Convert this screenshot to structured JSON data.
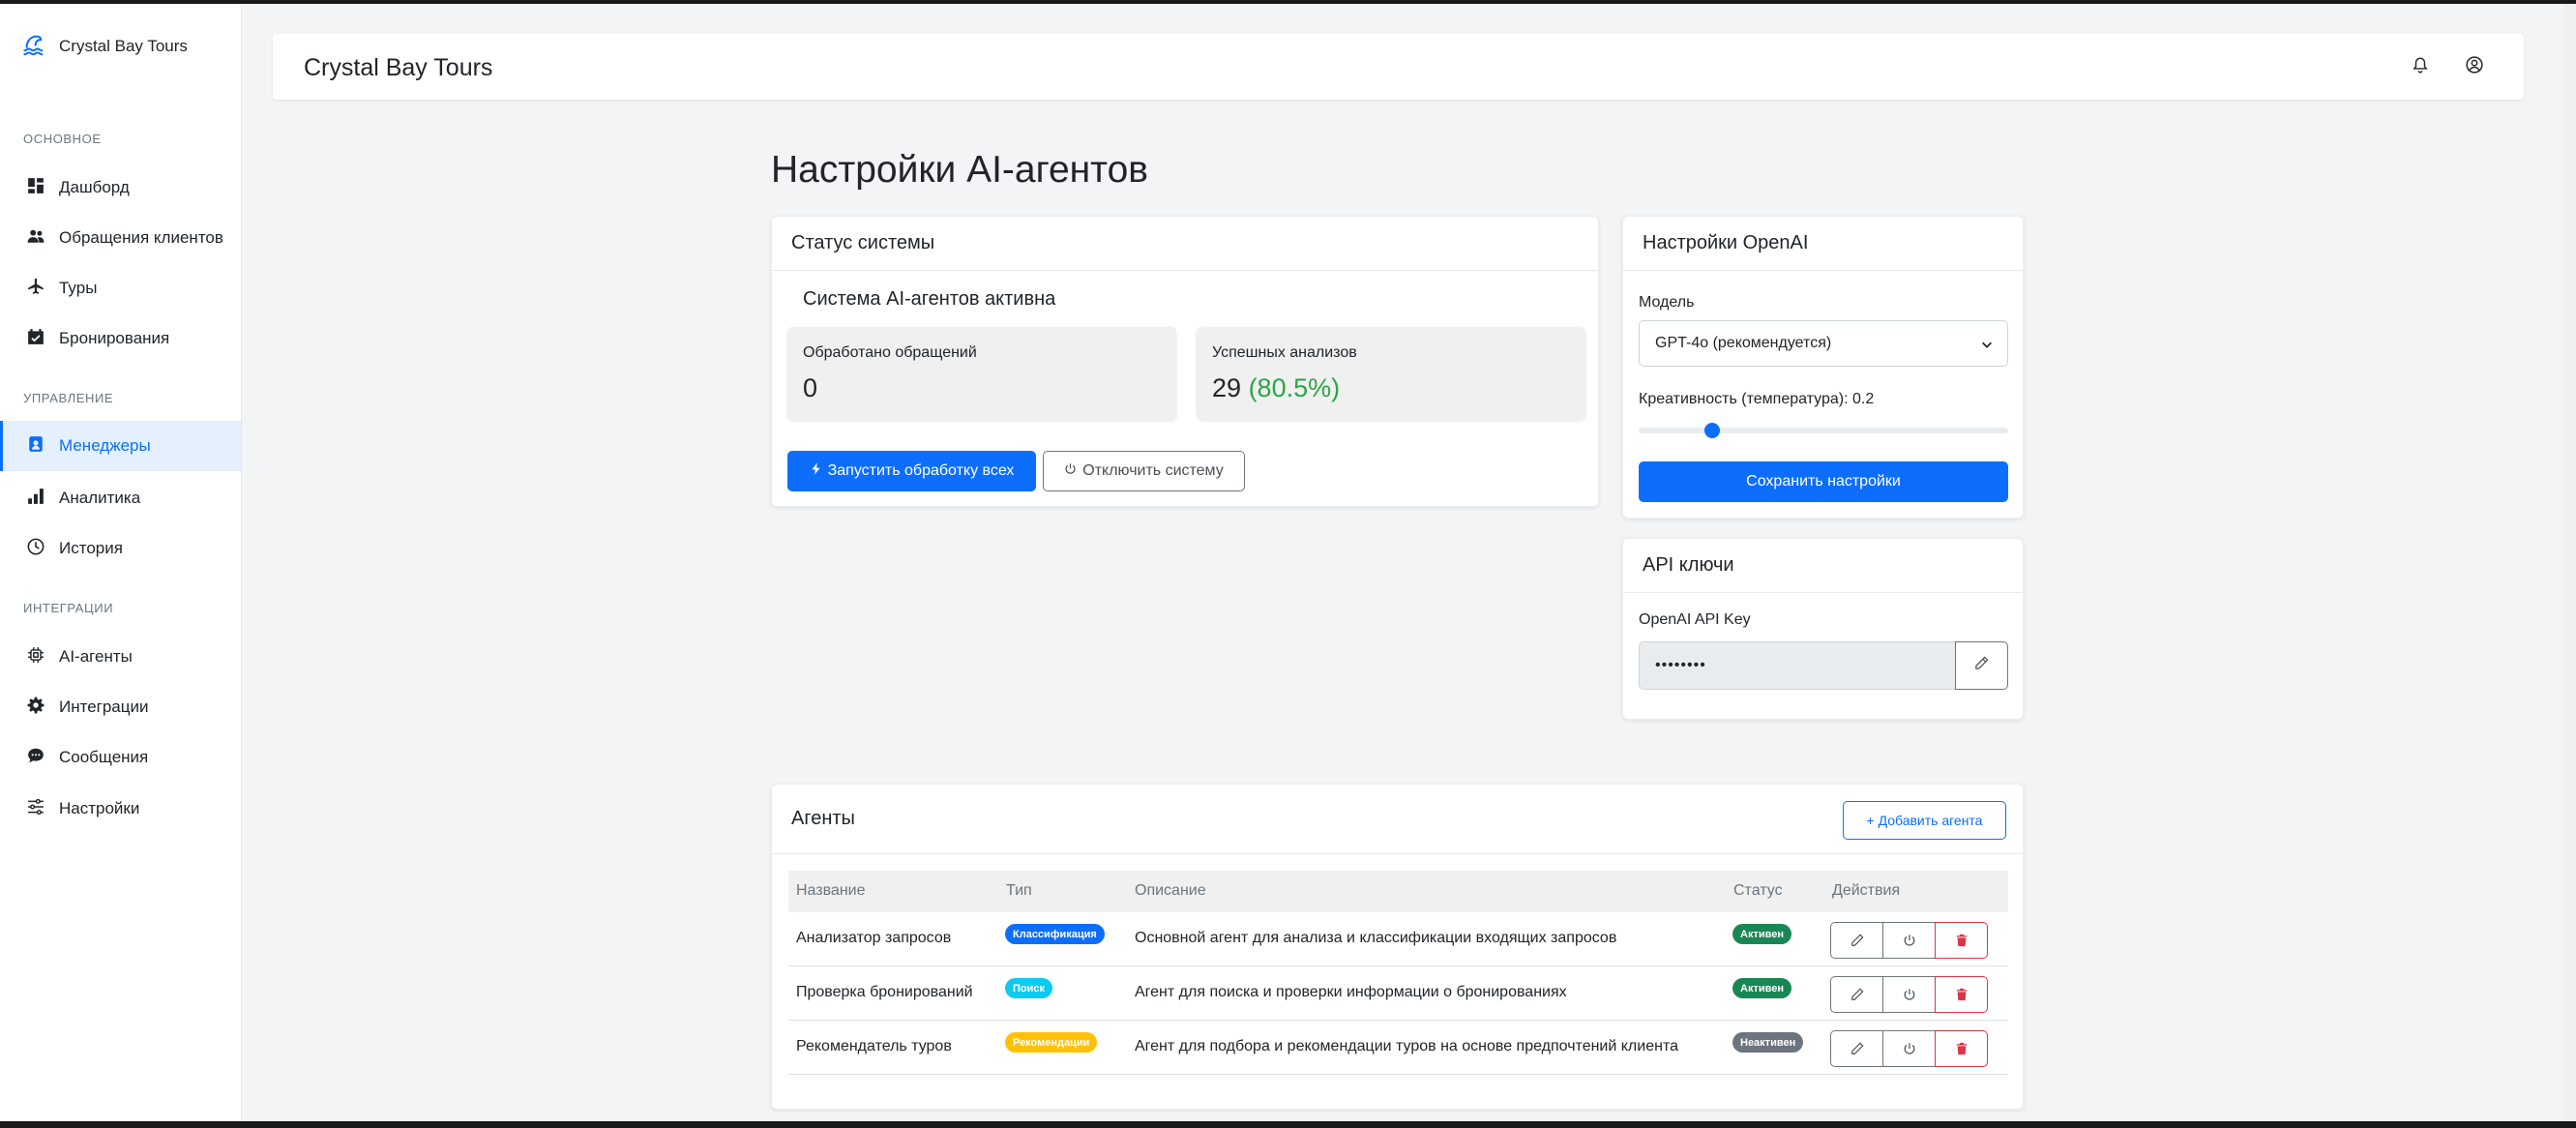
{
  "brand": {
    "name": "Crystal Bay Tours"
  },
  "sidebar": {
    "sections": [
      {
        "title": "ОСНОВНОЕ"
      },
      {
        "title": "УПРАВЛЕНИЕ"
      },
      {
        "title": "ИНТЕГРАЦИИ"
      }
    ],
    "items": [
      {
        "label": "Дашборд",
        "icon": "dashboard-icon"
      },
      {
        "label": "Обращения клиентов",
        "icon": "users-icon"
      },
      {
        "label": "Туры",
        "icon": "airplane-icon"
      },
      {
        "label": "Бронирования",
        "icon": "calendar-check-icon"
      },
      {
        "label": "Менеджеры",
        "icon": "person-badge-icon",
        "active": true
      },
      {
        "label": "Аналитика",
        "icon": "bar-chart-icon"
      },
      {
        "label": "История",
        "icon": "clock-icon"
      },
      {
        "label": "AI-агенты",
        "icon": "cpu-icon"
      },
      {
        "label": "Интеграции",
        "icon": "gear-icon"
      },
      {
        "label": "Сообщения",
        "icon": "chat-icon"
      },
      {
        "label": "Настройки",
        "icon": "sliders-icon"
      }
    ]
  },
  "header": {
    "title": "Crystal Bay Tours"
  },
  "page": {
    "title": "Настройки AI-агентов"
  },
  "system_status": {
    "card_title": "Статус системы",
    "status_text": "Система AI-агентов активна",
    "processed_label": "Обработано обращений",
    "processed_value": "0",
    "success_label": "Успешных анализов",
    "success_value": "29",
    "success_percent": "(80.5%)",
    "start_button": "Запустить обработку всех",
    "disable_button": "Отключить систему"
  },
  "openai": {
    "card_title": "Настройки OpenAI",
    "model_label": "Модель",
    "model_value": "GPT-4o (рекомендуется)",
    "temperature_label": "Креативность (температура): 0.2",
    "temperature_value": 0.2,
    "save_button": "Сохранить настройки"
  },
  "api_keys": {
    "card_title": "API ключи",
    "key_label": "OpenAI API Key",
    "key_value": "••••••••"
  },
  "agents": {
    "card_title": "Агенты",
    "add_button": "+ Добавить агента",
    "columns": [
      "Название",
      "Тип",
      "Описание",
      "Статус",
      "Действия"
    ],
    "rows": [
      {
        "name": "Анализатор запросов",
        "type": "Классификация",
        "description": "Основной агент для анализа и классификации входящих запросов",
        "status": "Активен"
      },
      {
        "name": "Проверка бронирований",
        "type": "Поиск",
        "description": "Агент для поиска и проверки информации о бронированиях",
        "status": "Активен"
      },
      {
        "name": "Рекомендатель туров",
        "type": "Рекомендации",
        "description": "Агент для подбора и рекомендации туров на основе предпочтений клиента",
        "status": "Неактивен"
      }
    ]
  },
  "colors": {
    "accent": "#0d6efd",
    "success": "#198754",
    "danger": "#dc3545",
    "percent": "#28a745"
  }
}
